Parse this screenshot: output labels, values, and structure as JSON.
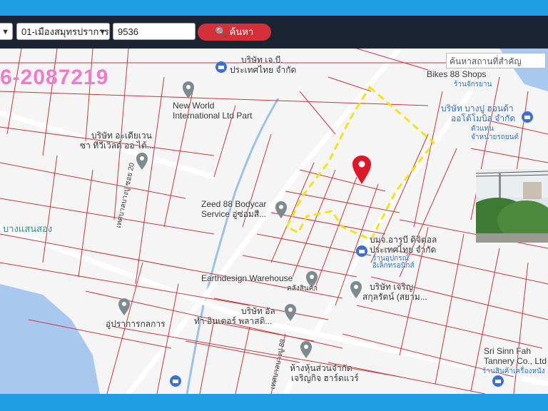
{
  "toolbar": {
    "province_value": "",
    "district_value": "01-เมืองสมุทรปราการ",
    "parcel_input_value": "9536",
    "search_label": "ค้นหา"
  },
  "map": {
    "phone_overlay": "6-2087219",
    "place_search_placeholder": "ค้นหาสถานที่สำคัญ",
    "labels": {
      "new_world_1": "New World",
      "new_world_2": "International Ltd Part",
      "company_a_1": "บริษัท อะเดียเวน",
      "company_a_2": "ซา ทีวีเวิลด์ ออ ไต้...",
      "top_company_1": "บริษัท เจ.บี.",
      "top_company_2": "ประเทศไทย จำกัด",
      "bikes_1": "Bikes 88 Shops",
      "bikes_2": "ร้านจักรยาน",
      "bangpu_1": "บริษัท บางปู ฮอนด้า",
      "bangpu_2": "ออโต้โมบิล จำกัด",
      "bangpu_3": "ตัวแทน",
      "bangpu_4": "จำหน่ายรถยนต์",
      "zeed_1": "Zeed 88 Bodycar",
      "zeed_2": "Service อู่ซ่อมสี...",
      "bangsaensong": "บางแสนสอง",
      "arubi_1": "บมจ.อารูบี ดิจิตอล",
      "arubi_2": "ประเทศไทย จำกัด",
      "arubi_3": "ร้านอุปกรณ์",
      "arubi_4": "อิเล็กทรอนิกส์",
      "earthdesign_1": "Earthdesign Warehouse",
      "earthdesign_2": "คลังสินค้า",
      "nakon_1": "บริษัท เจริญ",
      "nakon_2": "สกุลรัตน์ (สยาม...",
      "industry_1": "บริษัท อัล",
      "industry_2": "ทำ อินเตอร์ พลาสติ...",
      "garage": "อู่ปราการกลการ",
      "road_1": "เทศบาลบางปู ซอย 20",
      "road_2": "เทศบาลบางปู 88",
      "store_1": "ห้างหุ้นส่วนจำกัด",
      "store_2": "เจริญกิจ ฮาร์ดแวร์",
      "srisinn_1": "Sri Sinn Fah",
      "srisinn_2": "Tannery Co., Ltd",
      "srisinn_3": "ร้านสินค้าเครื่องหนัง"
    }
  },
  "colors": {
    "frame": "#1f9ee3",
    "toolbar": "#1c2333",
    "search_button": "#d4303a",
    "parcel_lines": "#c9363b",
    "highlight_boundary": "#f2e418",
    "marker": "#e0162b",
    "poi_pin": "#7d8a90",
    "phone_overlay": "#f07cc8",
    "water": "#a9c8f0"
  },
  "icons": [
    "search-icon",
    "location-marker-icon",
    "poi-pin-icon",
    "store-icon",
    "chevron-down-icon"
  ]
}
